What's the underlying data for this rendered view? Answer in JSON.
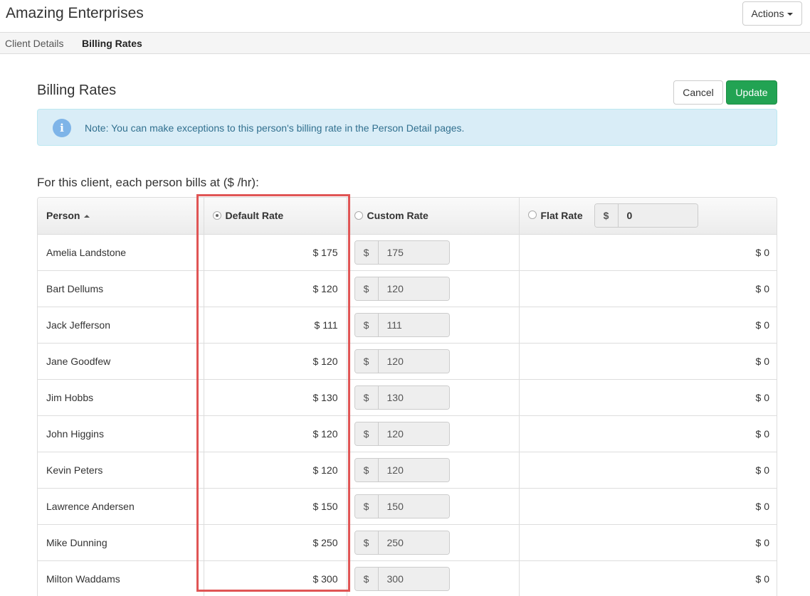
{
  "header": {
    "app_title": "Amazing Enterprises",
    "actions_label": "Actions"
  },
  "tabs": [
    {
      "label": "Client Details",
      "active": false
    },
    {
      "label": "Billing Rates",
      "active": true
    }
  ],
  "section": {
    "title": "Billing Rates",
    "cancel_label": "Cancel",
    "update_label": "Update"
  },
  "note": {
    "icon": "info-icon",
    "text": "Note: You can make exceptions to this person's billing rate in the Person Detail pages."
  },
  "intro_text": "For this client, each person bills at ($ /hr):",
  "colors": {
    "accent_green": "#22a353",
    "note_bg": "#d9edf7",
    "note_text": "#31708f",
    "highlight": "#e05555"
  },
  "table": {
    "columns": {
      "person": "Person",
      "default_rate": "Default Rate",
      "custom_rate": "Custom Rate",
      "flat_rate": "Flat Rate"
    },
    "selected_rate_type": "default_rate",
    "currency_symbol": "$",
    "flat_rate_value": "0",
    "rows": [
      {
        "person": "Amelia Landstone",
        "default_rate": "$ 175",
        "custom_rate": "175",
        "flat_rate": "$ 0"
      },
      {
        "person": "Bart Dellums",
        "default_rate": "$ 120",
        "custom_rate": "120",
        "flat_rate": "$ 0"
      },
      {
        "person": "Jack Jefferson",
        "default_rate": "$ 111",
        "custom_rate": "111",
        "flat_rate": "$ 0"
      },
      {
        "person": "Jane Goodfew",
        "default_rate": "$ 120",
        "custom_rate": "120",
        "flat_rate": "$ 0"
      },
      {
        "person": "Jim Hobbs",
        "default_rate": "$ 130",
        "custom_rate": "130",
        "flat_rate": "$ 0"
      },
      {
        "person": "John Higgins",
        "default_rate": "$ 120",
        "custom_rate": "120",
        "flat_rate": "$ 0"
      },
      {
        "person": "Kevin Peters",
        "default_rate": "$ 120",
        "custom_rate": "120",
        "flat_rate": "$ 0"
      },
      {
        "person": "Lawrence Andersen",
        "default_rate": "$ 150",
        "custom_rate": "150",
        "flat_rate": "$ 0"
      },
      {
        "person": "Mike Dunning",
        "default_rate": "$ 250",
        "custom_rate": "250",
        "flat_rate": "$ 0"
      },
      {
        "person": "Milton Waddams",
        "default_rate": "$ 300",
        "custom_rate": "300",
        "flat_rate": "$ 0"
      }
    ]
  }
}
